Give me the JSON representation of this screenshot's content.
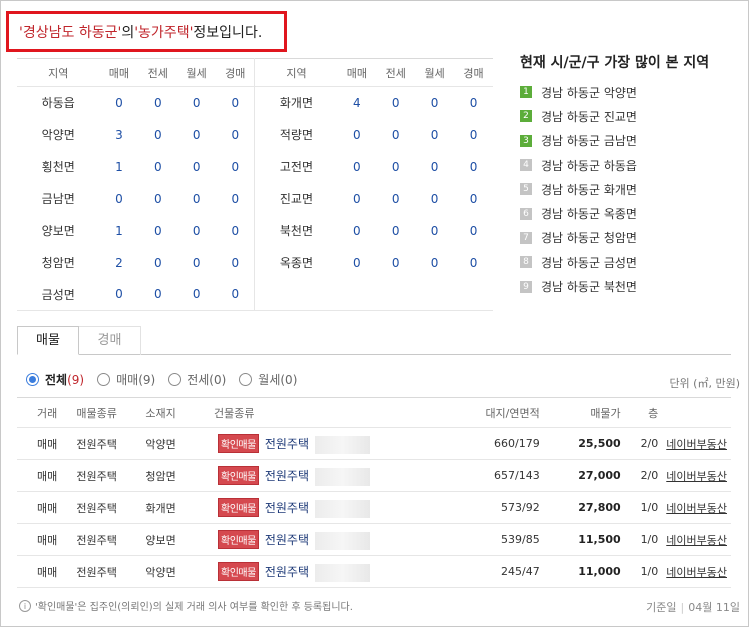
{
  "header": {
    "region": "'경상남도 하동군'",
    "connector": "의 ",
    "type": "'농가주택'",
    "suffix": " 정보입니다."
  },
  "region_table": {
    "headers": [
      "지역",
      "매매",
      "전세",
      "월세",
      "경매"
    ],
    "left": [
      {
        "name": "하동읍",
        "sale": "0",
        "jeonse": "0",
        "monthly": "0",
        "auction": "0"
      },
      {
        "name": "악양면",
        "sale": "3",
        "jeonse": "0",
        "monthly": "0",
        "auction": "0"
      },
      {
        "name": "횡천면",
        "sale": "1",
        "jeonse": "0",
        "monthly": "0",
        "auction": "0"
      },
      {
        "name": "금남면",
        "sale": "0",
        "jeonse": "0",
        "monthly": "0",
        "auction": "0"
      },
      {
        "name": "양보면",
        "sale": "1",
        "jeonse": "0",
        "monthly": "0",
        "auction": "0"
      },
      {
        "name": "청암면",
        "sale": "2",
        "jeonse": "0",
        "monthly": "0",
        "auction": "0"
      },
      {
        "name": "금성면",
        "sale": "0",
        "jeonse": "0",
        "monthly": "0",
        "auction": "0"
      }
    ],
    "right": [
      {
        "name": "화개면",
        "sale": "4",
        "jeonse": "0",
        "monthly": "0",
        "auction": "0"
      },
      {
        "name": "적량면",
        "sale": "0",
        "jeonse": "0",
        "monthly": "0",
        "auction": "0"
      },
      {
        "name": "고전면",
        "sale": "0",
        "jeonse": "0",
        "monthly": "0",
        "auction": "0"
      },
      {
        "name": "진교면",
        "sale": "0",
        "jeonse": "0",
        "monthly": "0",
        "auction": "0"
      },
      {
        "name": "북천면",
        "sale": "0",
        "jeonse": "0",
        "monthly": "0",
        "auction": "0"
      },
      {
        "name": "옥종면",
        "sale": "0",
        "jeonse": "0",
        "monthly": "0",
        "auction": "0"
      }
    ]
  },
  "top_regions": {
    "title": "현재 시/군/구 가장 많이 본 지역",
    "top_color": "#5cad3a",
    "other_color": "#c4c4c4",
    "items": [
      {
        "rank": "1",
        "label": "경남 하동군 악양면"
      },
      {
        "rank": "2",
        "label": "경남 하동군 진교면"
      },
      {
        "rank": "3",
        "label": "경남 하동군 금남면"
      },
      {
        "rank": "4",
        "label": "경남 하동군 하동읍"
      },
      {
        "rank": "5",
        "label": "경남 하동군 화개면"
      },
      {
        "rank": "6",
        "label": "경남 하동군 옥종면"
      },
      {
        "rank": "7",
        "label": "경남 하동군 청암면"
      },
      {
        "rank": "8",
        "label": "경남 하동군 금성면"
      },
      {
        "rank": "9",
        "label": "경남 하동군 북천면"
      }
    ]
  },
  "tabs": {
    "listings": "매물",
    "auction": "경매"
  },
  "filters": {
    "all": {
      "label": "전체",
      "count": "(9)"
    },
    "sale": {
      "label": "매매",
      "count": "(9)"
    },
    "jeonse": {
      "label": "전세",
      "count": "(0)"
    },
    "monthly": {
      "label": "월세",
      "count": "(0)"
    }
  },
  "unit_label": "단위 (㎡, 만원)",
  "listings": {
    "headers": {
      "deal": "거래",
      "type": "매물종류",
      "location": "소재지",
      "building": "건물종류",
      "area": "대지/연면적",
      "price": "매물가",
      "floor": "층"
    },
    "confirm_badge": "확인매물",
    "rows": [
      {
        "deal": "매매",
        "type": "전원주택",
        "location": "악양면",
        "building": "전원주택",
        "area": "660/179",
        "price": "25,500",
        "floor": "2/0",
        "agent": "네이버부동산"
      },
      {
        "deal": "매매",
        "type": "전원주택",
        "location": "청암면",
        "building": "전원주택",
        "area": "657/143",
        "price": "27,000",
        "floor": "2/0",
        "agent": "네이버부동산"
      },
      {
        "deal": "매매",
        "type": "전원주택",
        "location": "화개면",
        "building": "전원주택",
        "area": "573/92",
        "price": "27,800",
        "floor": "1/0",
        "agent": "네이버부동산"
      },
      {
        "deal": "매매",
        "type": "전원주택",
        "location": "양보면",
        "building": "전원주택",
        "area": "539/85",
        "price": "11,500",
        "floor": "1/0",
        "agent": "네이버부동산"
      },
      {
        "deal": "매매",
        "type": "전원주택",
        "location": "악양면",
        "building": "전원주택",
        "area": "245/47",
        "price": "11,000",
        "floor": "1/0",
        "agent": "네이버부동산"
      }
    ]
  },
  "footer": {
    "note": "'확인매물'은 집주인(의뢰인)의 실제 거래 의사 여부를 확인한 후 등록됩니다.",
    "base_label": "기준일",
    "base_date": "04월 11일"
  }
}
